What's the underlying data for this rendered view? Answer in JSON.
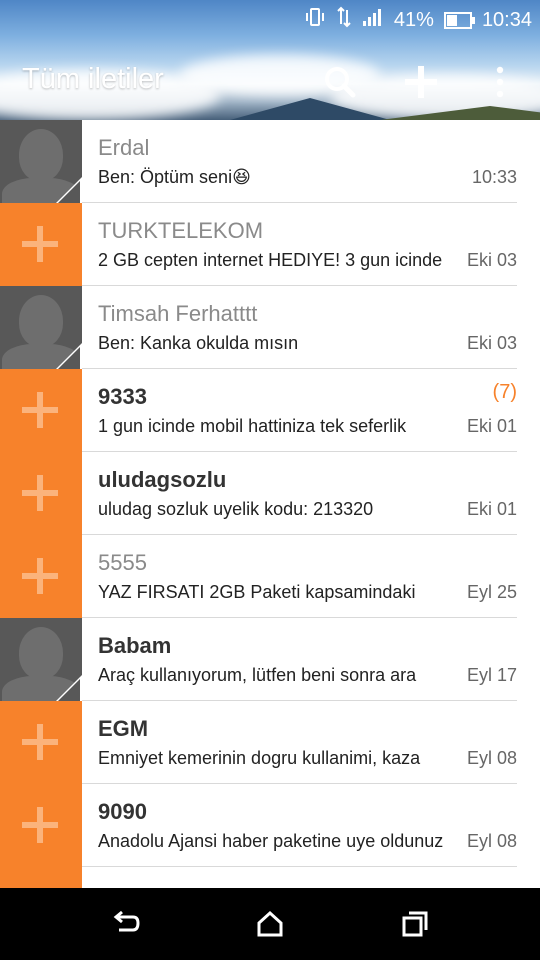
{
  "status_bar": {
    "battery_percent": "41%",
    "battery_level": 0.41,
    "time": "10:34",
    "icons": [
      "vibrate-icon",
      "data-arrows-icon",
      "signal-icon",
      "battery-icon"
    ]
  },
  "app_bar": {
    "title": "Tüm iletiler",
    "actions": [
      "search-icon",
      "add-icon",
      "overflow-menu-icon"
    ]
  },
  "conversations": [
    {
      "name": "Erdal",
      "snippet": "Ben: Öptüm seni😆",
      "time": "10:33",
      "unread_count": "",
      "avatar": "contact-photo-icon",
      "unread": false
    },
    {
      "name": "TURKTELEKOM",
      "snippet": "2 GB cepten internet HEDIYE! 3 gun icinde",
      "time": "Eki 03",
      "unread_count": "",
      "avatar": "add-contact-icon",
      "unread": false
    },
    {
      "name": "Timsah Ferhatttt",
      "snippet": "Ben: Kanka okulda mısın",
      "time": "Eki 03",
      "unread_count": "",
      "avatar": "contact-photo-icon",
      "unread": false
    },
    {
      "name": "9333",
      "snippet": "1 gun icinde mobil hattiniza tek seferlik",
      "time": "Eki 01",
      "unread_count": "(7)",
      "avatar": "add-contact-icon",
      "unread": true
    },
    {
      "name": "uludagsozlu",
      "snippet": "uludag sozluk uyelik kodu: 213320",
      "time": "Eki 01",
      "unread_count": "",
      "avatar": "add-contact-icon",
      "unread": true
    },
    {
      "name": "5555",
      "snippet": "YAZ FIRSATI 2GB Paketi kapsamindaki",
      "time": "Eyl 25",
      "unread_count": "",
      "avatar": "add-contact-icon",
      "unread": false
    },
    {
      "name": "Babam",
      "snippet": "Araç kullanıyorum, lütfen beni sonra ara",
      "time": "Eyl 17",
      "unread_count": "",
      "avatar": "contact-photo-icon",
      "unread": true
    },
    {
      "name": "EGM",
      "snippet": "Emniyet kemerinin dogru kullanimi, kaza",
      "time": "Eyl 08",
      "unread_count": "",
      "avatar": "add-contact-icon",
      "unread": true
    },
    {
      "name": "9090",
      "snippet": "Anadolu Ajansi haber paketine uye oldunuz",
      "time": "Eyl 08",
      "unread_count": "",
      "avatar": "add-contact-icon",
      "unread": true
    },
    {
      "name": "",
      "snippet": "",
      "time": "",
      "unread_count": "",
      "avatar": "add-contact-icon",
      "unread": true
    }
  ],
  "nav_bar": {
    "buttons": [
      "back-icon",
      "home-icon",
      "recent-apps-icon"
    ]
  },
  "colors": {
    "accent": "#f7822b",
    "avatar_photo_bg": "#585858",
    "nav_bg": "#000000"
  }
}
